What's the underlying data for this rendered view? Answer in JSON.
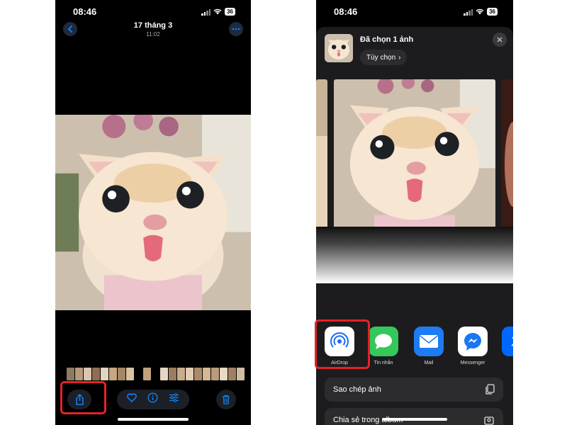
{
  "colors": {
    "highlight": "#e32227",
    "accent": "#0a84ff",
    "background": "#000000",
    "sheet": "#1c1c1e"
  },
  "left_screen": {
    "status": {
      "time": "08:46",
      "battery": "36"
    },
    "header": {
      "title": "17 tháng 3",
      "subtitle": "11:02"
    },
    "icons": {
      "back": "chevron-left-icon",
      "more": "ellipsis-icon",
      "share": "share-icon",
      "favorite": "heart-icon",
      "info": "info-icon",
      "edit": "sliders-icon",
      "delete": "trash-icon"
    }
  },
  "right_screen": {
    "status": {
      "time": "08:46",
      "battery": "36"
    },
    "sheet": {
      "title": "Đã chọn 1 ảnh",
      "options_label": "Tùy chọn",
      "options_chevron": "›"
    },
    "apps": [
      {
        "label": "AirDrop",
        "icon": "airdrop-icon"
      },
      {
        "label": "Tin nhắn",
        "icon": "messages-icon"
      },
      {
        "label": "Mail",
        "icon": "mail-icon"
      },
      {
        "label": "Messenger",
        "icon": "messenger-icon"
      },
      {
        "label": "",
        "icon": "zalo-icon"
      }
    ],
    "actions": [
      {
        "label": "Sao chép ảnh",
        "icon": "copy-icon"
      },
      {
        "label": "Chia sẻ trong album",
        "icon": "shared-album-icon"
      }
    ]
  }
}
